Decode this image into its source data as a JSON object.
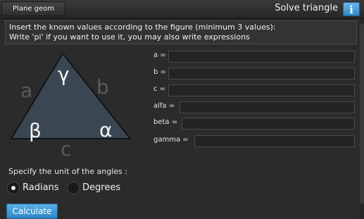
{
  "header": {
    "tab_label": "Plane geom",
    "tool_title": "Solve triangle",
    "info_label": "i"
  },
  "instructions": {
    "line1": "Insert the known values according to the figure (minimum 3 values):",
    "line2": "Write 'pi' if you want to use it, you may also write expressions"
  },
  "figure": {
    "side_a": "a",
    "side_b": "b",
    "side_c": "c",
    "angle_alpha": "α",
    "angle_beta": "β",
    "angle_gamma": "γ",
    "fill_color": "#3a4652",
    "side_label_color": "#5a5a5a"
  },
  "fields": {
    "a": {
      "label": "a =",
      "value": ""
    },
    "b": {
      "label": "b =",
      "value": ""
    },
    "c": {
      "label": "c =",
      "value": ""
    },
    "alfa": {
      "label": "alfa =",
      "value": ""
    },
    "beta": {
      "label": "beta =",
      "value": ""
    },
    "gamma": {
      "label": "gamma =",
      "value": ""
    }
  },
  "units": {
    "prompt": "Specify the unit of the angles :",
    "options": [
      "Radians",
      "Degrees"
    ],
    "selected": "Radians"
  },
  "calculate_label": "Calculate",
  "colors": {
    "accent": "#3a9ad9",
    "background": "#2b2b2b"
  }
}
